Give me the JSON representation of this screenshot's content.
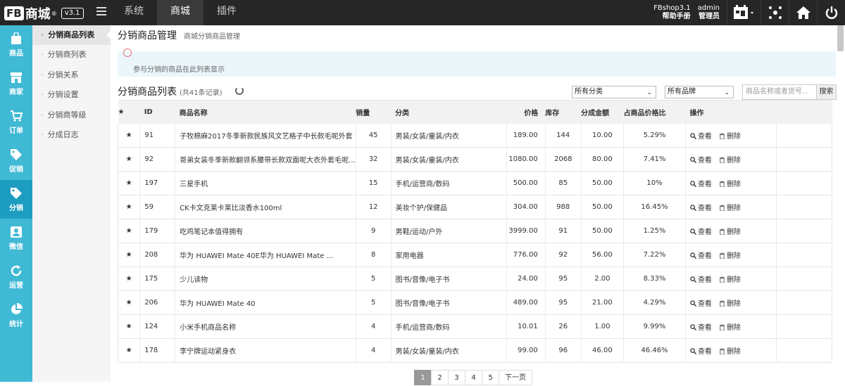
{
  "topbar": {
    "logo_fb": "FB",
    "logo_text": "商城",
    "logo_reg": "®",
    "version": "v3.1",
    "nav": [
      "系统",
      "商城",
      "插件"
    ],
    "shop_name": "FBshop3.1",
    "help": "帮助手册",
    "user": "admin",
    "role": "管理员"
  },
  "iconbar": [
    "商品",
    "商家",
    "订单",
    "促销",
    "分销",
    "微信",
    "运营",
    "统计"
  ],
  "submenu": [
    "分销商品列表",
    "分销商列表",
    "分销关系",
    "分销设置",
    "分销商等级",
    "分成日志"
  ],
  "page": {
    "title": "分销商品管理",
    "subtitle": "商城分销商品管理",
    "tip": "参与分销的商品在此列表显示",
    "list_title": "分销商品列表",
    "count": "(共41条记录)"
  },
  "filters": {
    "category": "所有分类",
    "brand": "所有品牌",
    "search_placeholder": "商品名称或者货号...",
    "search_button": "搜索"
  },
  "table": {
    "headers": [
      "ID",
      "商品名称",
      "销量",
      "分类",
      "价格",
      "库存",
      "分成金额",
      "占商品价格比",
      "操作"
    ],
    "view_label": "查看",
    "delete_label": "删除",
    "rows": [
      {
        "id": "91",
        "name": "子牧棉麻2017冬季新款民族风文艺格子中长款毛呢外套",
        "sales": "45",
        "cat": "男装/女装/童装/内衣",
        "price": "189.00",
        "stock": "144",
        "comm": "10.00",
        "ratio": "5.29%"
      },
      {
        "id": "92",
        "name": "哥弟女装冬季新款翻领系腰带长款双面呢大衣外套毛呢...",
        "sales": "32",
        "cat": "男装/女装/童装/内衣",
        "price": "1080.00",
        "stock": "2068",
        "comm": "80.00",
        "ratio": "7.41%"
      },
      {
        "id": "197",
        "name": "三星手机",
        "sales": "15",
        "cat": "手机/运营商/数码",
        "price": "500.00",
        "stock": "85",
        "comm": "50.00",
        "ratio": "10%"
      },
      {
        "id": "59",
        "name": "CK卡文克莱卡莱比淡香水100ml",
        "sales": "12",
        "cat": "美妆个护/保健品",
        "price": "304.00",
        "stock": "988",
        "comm": "50.00",
        "ratio": "16.45%"
      },
      {
        "id": "179",
        "name": "吃鸡笔记本值得拥有",
        "sales": "9",
        "cat": "男鞋/运动/户外",
        "price": "3999.00",
        "stock": "91",
        "comm": "50.00",
        "ratio": "1.25%"
      },
      {
        "id": "208",
        "name": "华为 HUAWEI Mate 40E华为 HUAWEI Mate ...",
        "sales": "8",
        "cat": "家用电器",
        "price": "776.00",
        "stock": "92",
        "comm": "56.00",
        "ratio": "7.22%"
      },
      {
        "id": "175",
        "name": "少儿读物",
        "sales": "5",
        "cat": "图书/音像/电子书",
        "price": "24.00",
        "stock": "95",
        "comm": "2.00",
        "ratio": "8.33%"
      },
      {
        "id": "206",
        "name": "华为 HUAWEI Mate 40",
        "sales": "5",
        "cat": "图书/音像/电子书",
        "price": "489.00",
        "stock": "95",
        "comm": "21.00",
        "ratio": "4.29%"
      },
      {
        "id": "124",
        "name": "小米手机商品名称",
        "sales": "4",
        "cat": "手机/运营商/数码",
        "price": "10.01",
        "stock": "26",
        "comm": "1.00",
        "ratio": "9.99%"
      },
      {
        "id": "178",
        "name": "李宁牌运动紧身衣",
        "sales": "4",
        "cat": "男装/女装/童装/内衣",
        "price": "99.00",
        "stock": "96",
        "comm": "46.00",
        "ratio": "46.46%"
      }
    ]
  },
  "pager": {
    "pages": [
      "1",
      "2",
      "3",
      "4",
      "5"
    ],
    "next": "下一页",
    "current": "1"
  },
  "colors": {
    "topbar": "#262626",
    "iconbar": "#40b9d5",
    "iconbar_active": "#1d9dc0",
    "tip_bg": "#eaf6fa"
  }
}
